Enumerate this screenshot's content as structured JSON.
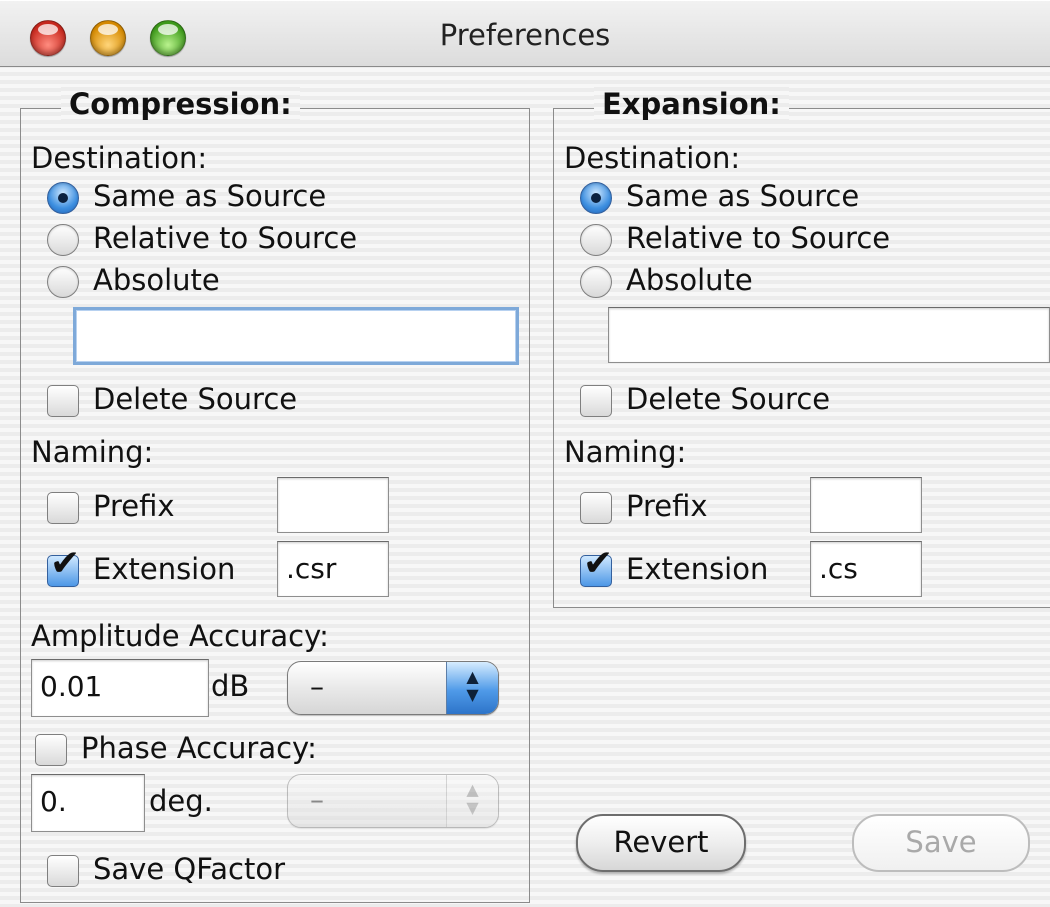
{
  "window": {
    "title": "Preferences"
  },
  "compression": {
    "group_title": "Compression:",
    "destination_label": "Destination:",
    "radio_same": "Same as Source",
    "radio_relative": "Relative to Source",
    "radio_absolute": "Absolute",
    "selected_destination": "Same as Source",
    "absolute_path_value": "",
    "delete_source_label": "Delete Source",
    "delete_source_checked": false,
    "naming_label": "Naming:",
    "prefix_label": "Prefix",
    "prefix_checked": false,
    "prefix_value": "",
    "extension_label": "Extension",
    "extension_checked": true,
    "extension_value": ".csr",
    "amplitude_label": "Amplitude Accuracy:",
    "amplitude_value": "0.01",
    "amplitude_unit": "dB",
    "amplitude_popup_value": "–",
    "phase_label": "Phase Accuracy:",
    "phase_checked": false,
    "phase_value": "0.",
    "phase_unit": "deg.",
    "phase_popup_value": "–",
    "save_qfactor_label": "Save QFactor",
    "save_qfactor_checked": false
  },
  "expansion": {
    "group_title": "Expansion:",
    "destination_label": "Destination:",
    "radio_same": "Same as Source",
    "radio_relative": "Relative to Source",
    "radio_absolute": "Absolute",
    "selected_destination": "Same as Source",
    "absolute_path_value": "",
    "delete_source_label": "Delete Source",
    "delete_source_checked": false,
    "naming_label": "Naming:",
    "prefix_label": "Prefix",
    "prefix_checked": false,
    "prefix_value": "",
    "extension_label": "Extension",
    "extension_checked": true,
    "extension_value": ".cs"
  },
  "buttons": {
    "revert": "Revert",
    "save": "Save"
  },
  "colors": {
    "accent_blue": "#3d8fe0",
    "close_red": "#c8281e",
    "minimize_yellow": "#d68a00",
    "zoom_green": "#3e9b1b"
  },
  "icons": {
    "close": "close-icon",
    "minimize": "minimize-icon",
    "zoom": "zoom-icon",
    "checkmark": "checkmark-icon",
    "popup_arrows": "updown-arrows-icon"
  }
}
